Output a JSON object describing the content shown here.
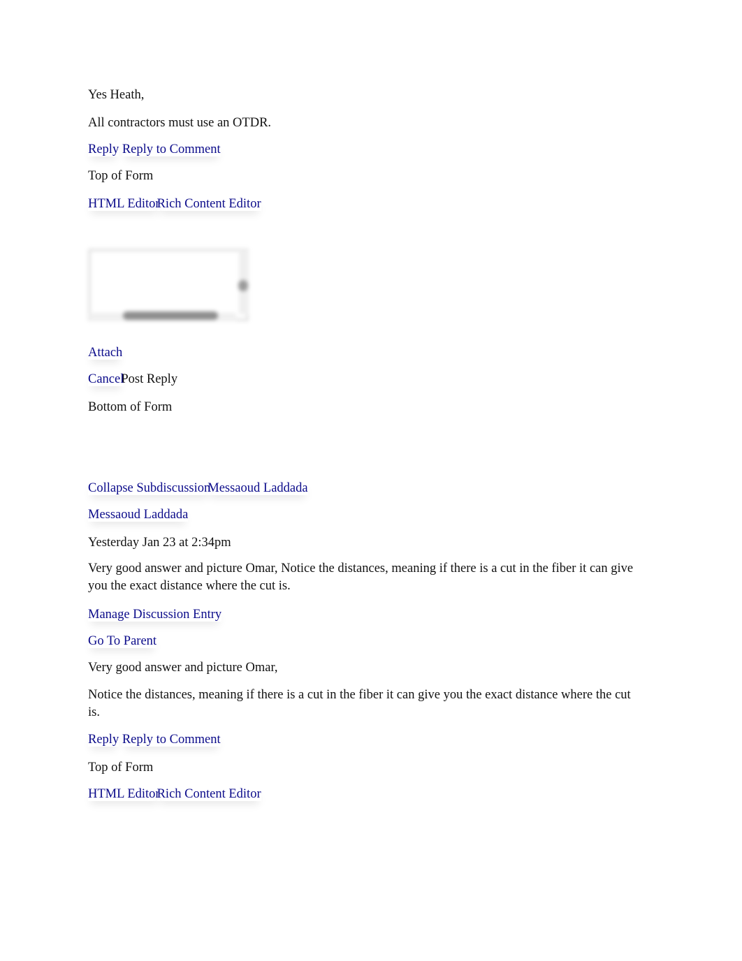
{
  "first_entry": {
    "greeting": "Yes Heath,",
    "body": "All contractors must use an OTDR.",
    "reply_label": "Reply",
    "reply_to_comment_label": "Reply to Comment",
    "top_of_form": "Top of Form",
    "html_editor_label": "HTML Editor",
    "rich_content_editor_label": "Rich Content Editor",
    "reply_textarea_value": "",
    "attach_label": "Attach",
    "cancel_label": "Cancel",
    "post_reply_label": "Post Reply",
    "bottom_of_form": "Bottom of Form"
  },
  "second_entry": {
    "collapse_label": "Collapse Subdiscussion",
    "author_link_inline": "Messaoud Laddada",
    "author": "Messaoud Laddada",
    "timestamp": "Yesterday Jan 23 at 2:34pm",
    "summary": "Very good answer and picture Omar, Notice the distances, meaning if there is a cut in the fiber it can give you the exact distance where the cut is.",
    "manage_label": "Manage Discussion Entry",
    "go_to_parent_label": "Go To Parent",
    "body_line1": "Very good answer and picture Omar,",
    "body_line2": "Notice the distances, meaning if there is a cut in the fiber it can give you the exact distance where the cut is.",
    "reply_label": "Reply",
    "reply_to_comment_label": "Reply to Comment",
    "top_of_form": "Top of Form",
    "html_editor_label": "HTML Editor",
    "rich_content_editor_label": "Rich Content Editor"
  },
  "colors": {
    "link": "#0b0b8a",
    "text": "#111111",
    "background": "#ffffff"
  }
}
